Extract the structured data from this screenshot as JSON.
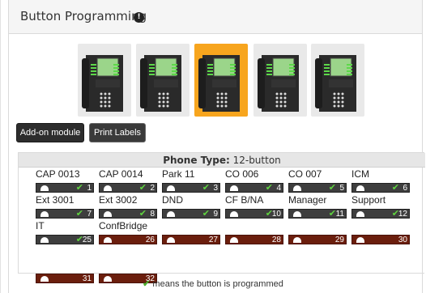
{
  "header": {
    "title": "Button Programming",
    "info_icon": "info-icon"
  },
  "phones": [
    {
      "id": "phone-1",
      "active": false
    },
    {
      "id": "phone-2",
      "active": false
    },
    {
      "id": "phone-3",
      "active": true
    },
    {
      "id": "phone-4",
      "active": false
    },
    {
      "id": "phone-5",
      "active": false
    }
  ],
  "buttons": {
    "addon": "Add-on module",
    "print": "Print Labels"
  },
  "grid": {
    "type_label": "Phone Type:",
    "type_value": "12-button",
    "slots": [
      {
        "label": "CAP 0013",
        "num": "1",
        "programmed": true
      },
      {
        "label": "CAP 0014",
        "num": "2",
        "programmed": true
      },
      {
        "label": "Park 11",
        "num": "3",
        "programmed": true
      },
      {
        "label": "CO 006",
        "num": "4",
        "programmed": true
      },
      {
        "label": "CO 007",
        "num": "5",
        "programmed": true
      },
      {
        "label": "ICM",
        "num": "6",
        "programmed": true
      },
      {
        "label": "Ext 3001",
        "num": "7",
        "programmed": true
      },
      {
        "label": "Ext 3002",
        "num": "8",
        "programmed": true
      },
      {
        "label": "DND",
        "num": "9",
        "programmed": true
      },
      {
        "label": "CF B/NA",
        "num": "10",
        "programmed": true
      },
      {
        "label": "Manager",
        "num": "11",
        "programmed": true
      },
      {
        "label": "Support",
        "num": "12",
        "programmed": true
      },
      {
        "label": "IT",
        "num": "25",
        "programmed": true
      },
      {
        "label": "ConfBridge",
        "num": "26",
        "programmed": false
      },
      {
        "label": "",
        "num": "27",
        "programmed": false
      },
      {
        "label": "",
        "num": "28",
        "programmed": false
      },
      {
        "label": "",
        "num": "29",
        "programmed": false
      },
      {
        "label": "",
        "num": "30",
        "programmed": false
      },
      {
        "label": "",
        "num": "31",
        "programmed": false
      },
      {
        "label": "",
        "num": "32",
        "programmed": false
      }
    ]
  },
  "legend": {
    "mark": "✔",
    "text": "means the button is programmed"
  },
  "colors": {
    "programmed_bar": "#3e3e3e",
    "unprogrammed_bar": "#6b1e0d",
    "check_green": "#5fd43f",
    "active_phone_bg": "#f7a51e"
  }
}
